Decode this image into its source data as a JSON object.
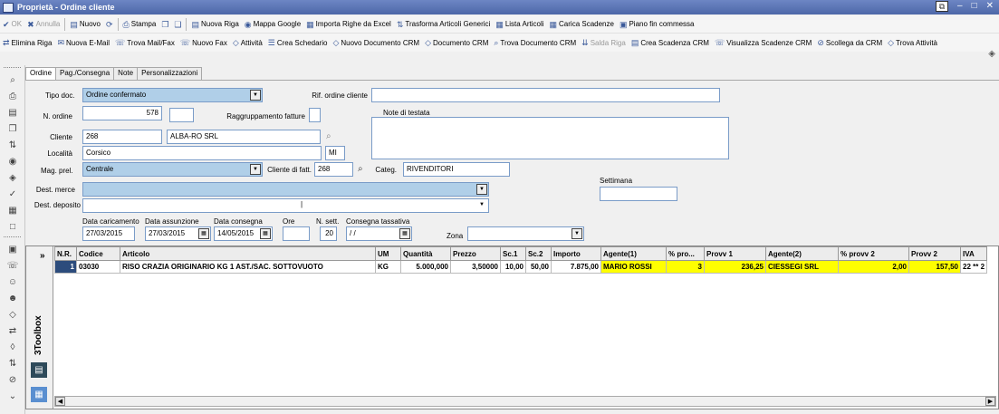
{
  "window": {
    "title": "Proprietà - Ordine cliente"
  },
  "toolbar1": [
    {
      "icon": "check-icon",
      "glyph": "✔",
      "label": "OK",
      "disabled": true
    },
    {
      "icon": "cancel-icon",
      "glyph": "✖",
      "label": "Annulla",
      "disabled": true
    },
    {
      "icon": "new-doc-icon",
      "glyph": "▤",
      "label": "Nuovo",
      "disabled": false
    },
    {
      "icon": "refresh-icon",
      "glyph": "⟳",
      "label": "",
      "disabled": false
    },
    {
      "icon": "print-icon",
      "glyph": "⎙",
      "label": "Stampa",
      "disabled": false
    },
    {
      "icon": "copy-icon",
      "glyph": "❐",
      "label": "",
      "disabled": false
    },
    {
      "icon": "paste-icon",
      "glyph": "❑",
      "label": "",
      "disabled": false
    },
    {
      "icon": "new-row-icon",
      "glyph": "▤",
      "label": "Nuova Riga",
      "disabled": false
    },
    {
      "icon": "globe-icon",
      "glyph": "◉",
      "label": "Mappa Google",
      "disabled": false
    },
    {
      "icon": "excel-icon",
      "glyph": "▦",
      "label": "Importa Righe da Excel",
      "disabled": false
    },
    {
      "icon": "transform-icon",
      "glyph": "⇅",
      "label": "Trasforma Articoli Generici",
      "disabled": false
    },
    {
      "icon": "list-icon",
      "glyph": "▦",
      "label": "Lista Articoli",
      "disabled": false
    },
    {
      "icon": "deadline-icon",
      "glyph": "▦",
      "label": "Carica Scadenze",
      "disabled": false
    },
    {
      "icon": "plan-icon",
      "glyph": "▣",
      "label": "Piano fin commessa",
      "disabled": false
    }
  ],
  "toolbar2": [
    {
      "icon": "delete-row-icon",
      "glyph": "⇄",
      "label": "Elimina Riga",
      "disabled": false
    },
    {
      "icon": "email-icon",
      "glyph": "✉",
      "label": "Nuova E-Mail",
      "disabled": false
    },
    {
      "icon": "fax-search-icon",
      "glyph": "☏",
      "label": "Trova Mail/Fax",
      "disabled": false
    },
    {
      "icon": "fax-icon",
      "glyph": "☏",
      "label": "Nuovo Fax",
      "disabled": false
    },
    {
      "icon": "activity-icon",
      "glyph": "◇",
      "label": "Attività",
      "disabled": false
    },
    {
      "icon": "schedule-icon",
      "glyph": "☰",
      "label": "Crea Schedario",
      "disabled": false
    },
    {
      "icon": "crm-new-icon",
      "glyph": "◇",
      "label": "Nuovo Documento CRM",
      "disabled": false
    },
    {
      "icon": "crm-doc-icon",
      "glyph": "◇",
      "label": "Documento CRM",
      "disabled": false
    },
    {
      "icon": "crm-find-icon",
      "glyph": "⌕",
      "label": "Trova Documento CRM",
      "disabled": false
    },
    {
      "icon": "save-row-icon",
      "glyph": "⇊",
      "label": "Salda Riga",
      "disabled": true
    },
    {
      "icon": "create-deadline-icon",
      "glyph": "▤",
      "label": "Crea Scadenza CRM",
      "disabled": false
    },
    {
      "icon": "view-deadline-icon",
      "glyph": "☏",
      "label": "Visualizza Scadenze CRM",
      "disabled": false
    },
    {
      "icon": "unlink-icon",
      "glyph": "⊘",
      "label": "Scollega da CRM",
      "disabled": false
    },
    {
      "icon": "find-activity-icon",
      "glyph": "◇",
      "label": "Trova Attività",
      "disabled": false
    }
  ],
  "tabs": [
    "Ordine",
    "Pag./Consegna",
    "Note",
    "Personalizzazioni"
  ],
  "form": {
    "tipo_doc_label": "Tipo doc.",
    "tipo_doc_value": "Ordine confermato",
    "rif_ordine_label": "Rif. ordine cliente",
    "rif_ordine_value": "",
    "n_ordine_label": "N. ordine",
    "n_ordine_value": "578",
    "n_ordine_suffix": "",
    "raggruppamento_label": "Raggruppamento fatture",
    "note_testata_label": "Note di testata",
    "note_testata_value": "",
    "cliente_label": "Cliente",
    "cliente_code": "268",
    "cliente_name": "ALBA-RO SRL",
    "localita_label": "Località",
    "localita_value": "Corsico",
    "provincia_value": "MI",
    "mag_prel_label": "Mag. prel.",
    "mag_prel_value": "Centrale",
    "cliente_fatt_label": "Cliente di fatt.",
    "cliente_fatt_value": "268",
    "categ_label": "Categ.",
    "categ_value": "RIVENDITORI",
    "settimana_label": "Settimana",
    "settimana_value": "",
    "dest_merce_label": "Dest. merce",
    "dest_merce_value": "",
    "dest_deposito_label": "Dest. deposito",
    "dest_deposito_value": "",
    "data_caricamento_label": "Data caricamento",
    "data_caricamento_value": "27/03/2015",
    "data_assunzione_label": "Data assunzione",
    "data_assunzione_value": "27/03/2015",
    "data_consegna_label": "Data consegna",
    "data_consegna_value": "14/05/2015",
    "ore_label": "Ore",
    "ore_value": "",
    "n_sett_label": "N. sett.",
    "n_sett_value": "20",
    "consegna_tassativa_label": "Consegna tassativa",
    "consegna_tassativa_value": "/ /",
    "zona_label": "Zona",
    "zona_value": ""
  },
  "grid": {
    "expand_label": "»",
    "toolbox_label": "3Toolbox",
    "columns": [
      "N.R.",
      "Codice",
      "Articolo",
      "UM",
      "Quantità",
      "Prezzo",
      "Sc.1",
      "Sc.2",
      "Importo",
      "Agente(1)",
      "% pro...",
      "Provv 1",
      "Agente(2)",
      "% provv 2",
      "Provv 2",
      "IVA"
    ],
    "rows": [
      {
        "nr": "1",
        "codice": "03030",
        "articolo": "RISO CRAZIA ORIGINARIO KG 1 AST./SAC. SOTTOVUOTO",
        "um": "KG",
        "quantita": "5.000,000",
        "prezzo": "3,50000",
        "sc1": "10,00",
        "sc2": "50,00",
        "importo": "7.875,00",
        "agente1": "MARIO ROSSI",
        "perc1": "3",
        "provv1": "236,25",
        "agente2": "CIESSEGI SRL",
        "perc2": "2,00",
        "provv2": "157,50",
        "iva": "22 ** 2"
      }
    ]
  },
  "colors": {
    "title_bar": "#4d67a8",
    "field_border": "#7a9cc8",
    "field_highlight": "#b0cfe8",
    "selected_row": "#2c4c7c",
    "agent_highlight": "#ffff00"
  }
}
